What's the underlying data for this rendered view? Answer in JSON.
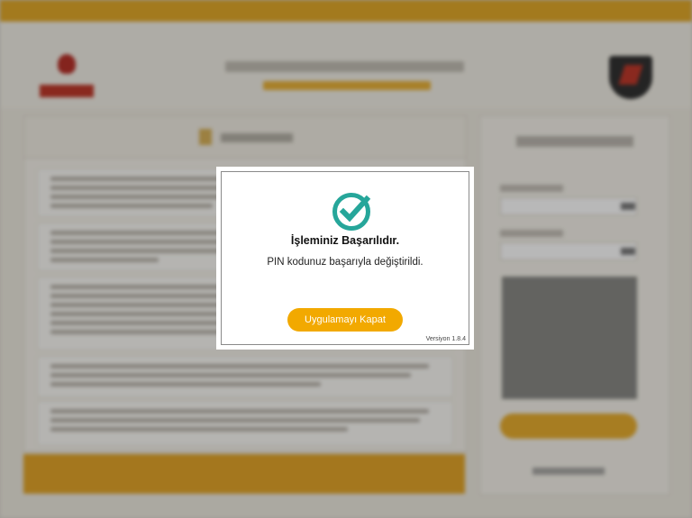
{
  "dialog": {
    "title": "İşleminiz Başarılıdır.",
    "message": "PIN kodunuz başarıyla değiştirildi.",
    "close_button_label": "Uygulamayı Kapat",
    "version": "Versiyon 1.8.4",
    "icon": "check-circle-icon",
    "icon_color": "#26a69a",
    "button_color": "#f2a900"
  },
  "colors": {
    "accent": "#e2a92a",
    "overlay": "rgba(0,0,0,0.28)"
  }
}
